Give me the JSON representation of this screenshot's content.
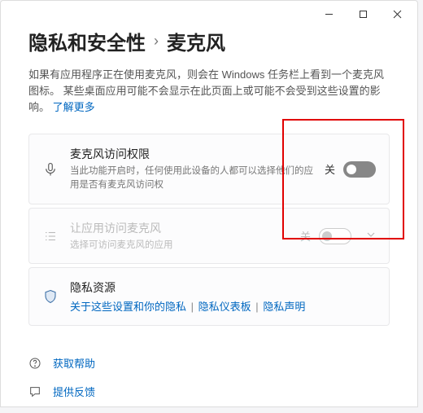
{
  "breadcrumb": {
    "parent": "隐私和安全性",
    "separator": "›",
    "current": "麦克风"
  },
  "description": {
    "text": "如果有应用程序正在使用麦克风，则会在 Windows 任务栏上看到一个麦克风图标。 某些桌面应用可能不会显示在此页面上或可能不会受到这些设置的影响。 ",
    "learn_more": "了解更多"
  },
  "access_card": {
    "title": "麦克风访问权限",
    "subtitle": "当此功能开启时，任何使用此设备的人都可以选择他们的应用是否有麦克风访问权",
    "toggle_label": "关"
  },
  "apps_card": {
    "title": "让应用访问麦克风",
    "subtitle": "选择可访问麦克风的应用",
    "toggle_label": "关"
  },
  "resources_card": {
    "title": "隐私资源",
    "link1": "关于这些设置和你的隐私",
    "link2": "隐私仪表板",
    "link3": "隐私声明"
  },
  "footer": {
    "help": "获取帮助",
    "feedback": "提供反馈"
  }
}
